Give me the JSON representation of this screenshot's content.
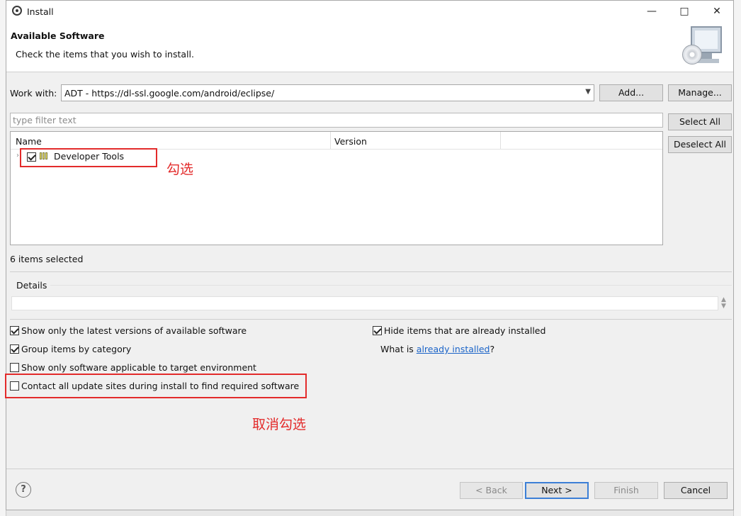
{
  "window": {
    "title": "Install",
    "minimize_glyph": "—",
    "maximize_glyph": "□",
    "close_glyph": "✕"
  },
  "header": {
    "title": "Available Software",
    "description": "Check the items that you wish to install.",
    "icon": "monitor-cd-icon"
  },
  "work_with": {
    "label": "Work with:",
    "value": "ADT - https://dl-ssl.google.com/android/eclipse/",
    "add_label": "Add...",
    "manage_label": "Manage..."
  },
  "filter": {
    "placeholder": "type filter text",
    "value": ""
  },
  "buttons": {
    "select_all": "Select All",
    "deselect_all": "Deselect All"
  },
  "tree": {
    "columns": [
      "Name",
      "Version"
    ],
    "items": [
      {
        "label": "Developer Tools",
        "checked": true,
        "version": ""
      }
    ]
  },
  "annotations": {
    "check_note": "勾选",
    "uncheck_note": "取消勾选",
    "color": "#e32b2b"
  },
  "selection_status": "6 items selected",
  "details": {
    "label": "Details",
    "value": ""
  },
  "options": {
    "latest_versions": {
      "label": "Show only the latest versions of available software",
      "checked": true
    },
    "group_by_category": {
      "label": "Group items by category",
      "checked": true
    },
    "target_env": {
      "label": "Show only software applicable to target environment",
      "checked": false
    },
    "contact_sites": {
      "label": "Contact all update sites during install to find required software",
      "checked": false
    },
    "hide_installed": {
      "label": "Hide items that are already installed",
      "checked": true
    },
    "what_is_prefix": "What is ",
    "what_is_link": "already installed",
    "what_is_suffix": "?"
  },
  "footer": {
    "help_glyph": "?",
    "back": "< Back",
    "next": "Next >",
    "finish": "Finish",
    "cancel": "Cancel"
  }
}
